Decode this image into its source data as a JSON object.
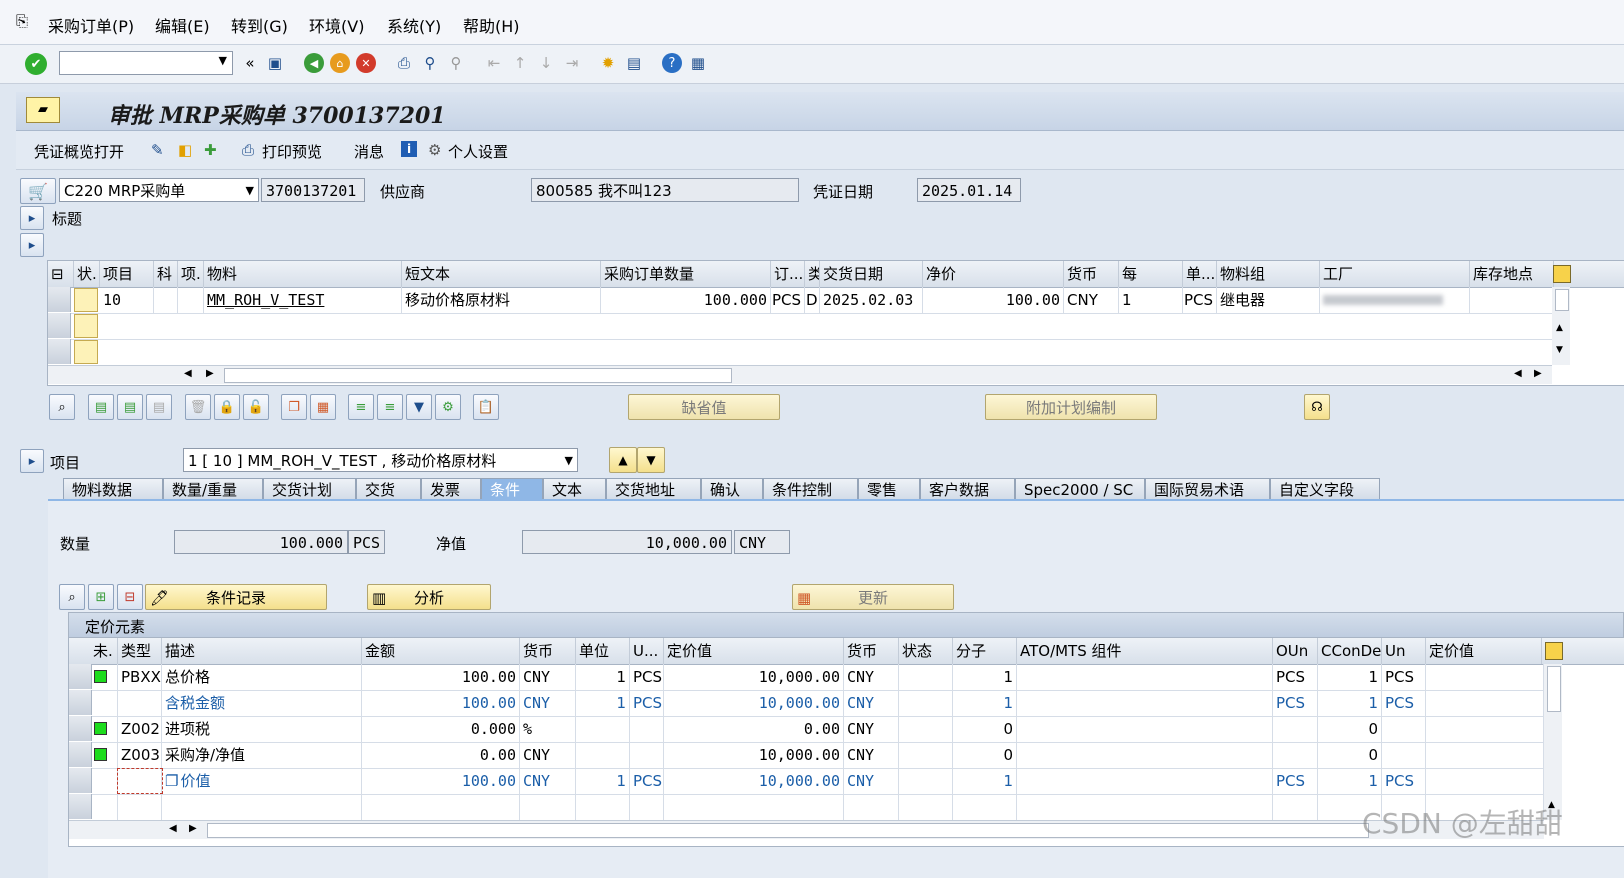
{
  "menu": [
    "采购订单(P)",
    "编辑(E)",
    "转到(G)",
    "环境(V)",
    "系统(Y)",
    "帮助(H)"
  ],
  "window_title": "审批 MRP采购单 3700137201",
  "app_toolbar": {
    "overview_open": "凭证概览打开",
    "print_preview": "打印预览",
    "messages": "消息",
    "personal_settings": "个人设置"
  },
  "header": {
    "doc_type": "C220 MRP采购单",
    "po_number": "3700137201",
    "vendor_label": "供应商",
    "vendor_value": "800585 我不叫123",
    "doc_date_label": "凭证日期",
    "doc_date_value": "2025.01.14",
    "title_section": "标题"
  },
  "item_grid": {
    "columns": [
      "状.",
      "项目",
      "科",
      "项.",
      "物料",
      "短文本",
      "采购订单数量",
      "订...",
      "类",
      "交货日期",
      "净价",
      "货币",
      "每",
      "单...",
      "物料组",
      "工厂",
      "库存地点"
    ],
    "rows": [
      {
        "item": "10",
        "material": "MM_ROH_V_TEST",
        "short_text": "移动价格原材料",
        "qty": "100.000",
        "unit": "PCS",
        "date_cat": "D",
        "delivery_date": "2025.02.03",
        "net_price": "100.00",
        "currency": "CNY",
        "per": "1",
        "order_unit": "PCS",
        "material_group": "继电器"
      }
    ]
  },
  "item_buttons": {
    "default_values": "缺省值",
    "additional_planning": "附加计划编制"
  },
  "item_detail": {
    "label": "项目",
    "selector_value": "1 [ 10 ] MM_ROH_V_TEST , 移动价格原材料"
  },
  "tabs": [
    "物料数据",
    "数量/重量",
    "交货计划",
    "交货",
    "发票",
    "条件",
    "文本",
    "交货地址",
    "确认",
    "条件控制",
    "零售",
    "客户数据",
    "Spec2000 / SC",
    "国际贸易术语",
    "自定义字段"
  ],
  "active_tab": "条件",
  "conditions": {
    "qty_label": "数量",
    "qty_value": "100.000",
    "qty_unit": "PCS",
    "net_label": "净值",
    "net_value": "10,000.00",
    "net_currency": "CNY",
    "btn_condition_record": "条件记录",
    "btn_analysis": "分析",
    "btn_update": "更新",
    "pricing_title": "定价元素",
    "columns": [
      "未.",
      "类型",
      "描述",
      "金额",
      "货币",
      "单位",
      "U...",
      "定价值",
      "货币",
      "状态",
      "分子",
      "ATO/MTS 组件",
      "OUn",
      "CConDe",
      "Un",
      "定价值"
    ],
    "rows": [
      {
        "flag": true,
        "type": "PBXX",
        "desc": "总价格",
        "amount": "100.00",
        "curr": "CNY",
        "per": "1",
        "uom": "PCS",
        "value": "10,000.00",
        "curr2": "CNY",
        "num": "1",
        "oun": "PCS",
        "ccon": "1",
        "un": "PCS",
        "blue": false
      },
      {
        "flag": false,
        "type": "",
        "desc": "含税金额",
        "amount": "100.00",
        "curr": "CNY",
        "per": "1",
        "uom": "PCS",
        "value": "10,000.00",
        "curr2": "CNY",
        "num": "1",
        "oun": "PCS",
        "ccon": "1",
        "un": "PCS",
        "blue": true
      },
      {
        "flag": true,
        "type": "Z002",
        "desc": "进项税",
        "amount": "0.000",
        "curr": "%",
        "per": "",
        "uom": "",
        "value": "0.00",
        "curr2": "CNY",
        "num": "0",
        "oun": "",
        "ccon": "0",
        "un": "",
        "blue": false
      },
      {
        "flag": true,
        "type": "Z003",
        "desc": "采购净/净值",
        "amount": "0.00",
        "curr": "CNY",
        "per": "",
        "uom": "",
        "value": "10,000.00",
        "curr2": "CNY",
        "num": "0",
        "oun": "",
        "ccon": "0",
        "un": "",
        "blue": false
      },
      {
        "flag": false,
        "type": "",
        "desc": "价值",
        "amount": "100.00",
        "curr": "CNY",
        "per": "1",
        "uom": "PCS",
        "value": "10,000.00",
        "curr2": "CNY",
        "num": "1",
        "oun": "PCS",
        "ccon": "1",
        "un": "PCS",
        "blue": true
      }
    ]
  },
  "watermark": "CSDN @左甜甜",
  "colors": {
    "accent": "#8fb7e6",
    "button_yellow": "#f4e08c",
    "status_green": "#1ddc1d",
    "link_blue": "#1b5ea8"
  }
}
